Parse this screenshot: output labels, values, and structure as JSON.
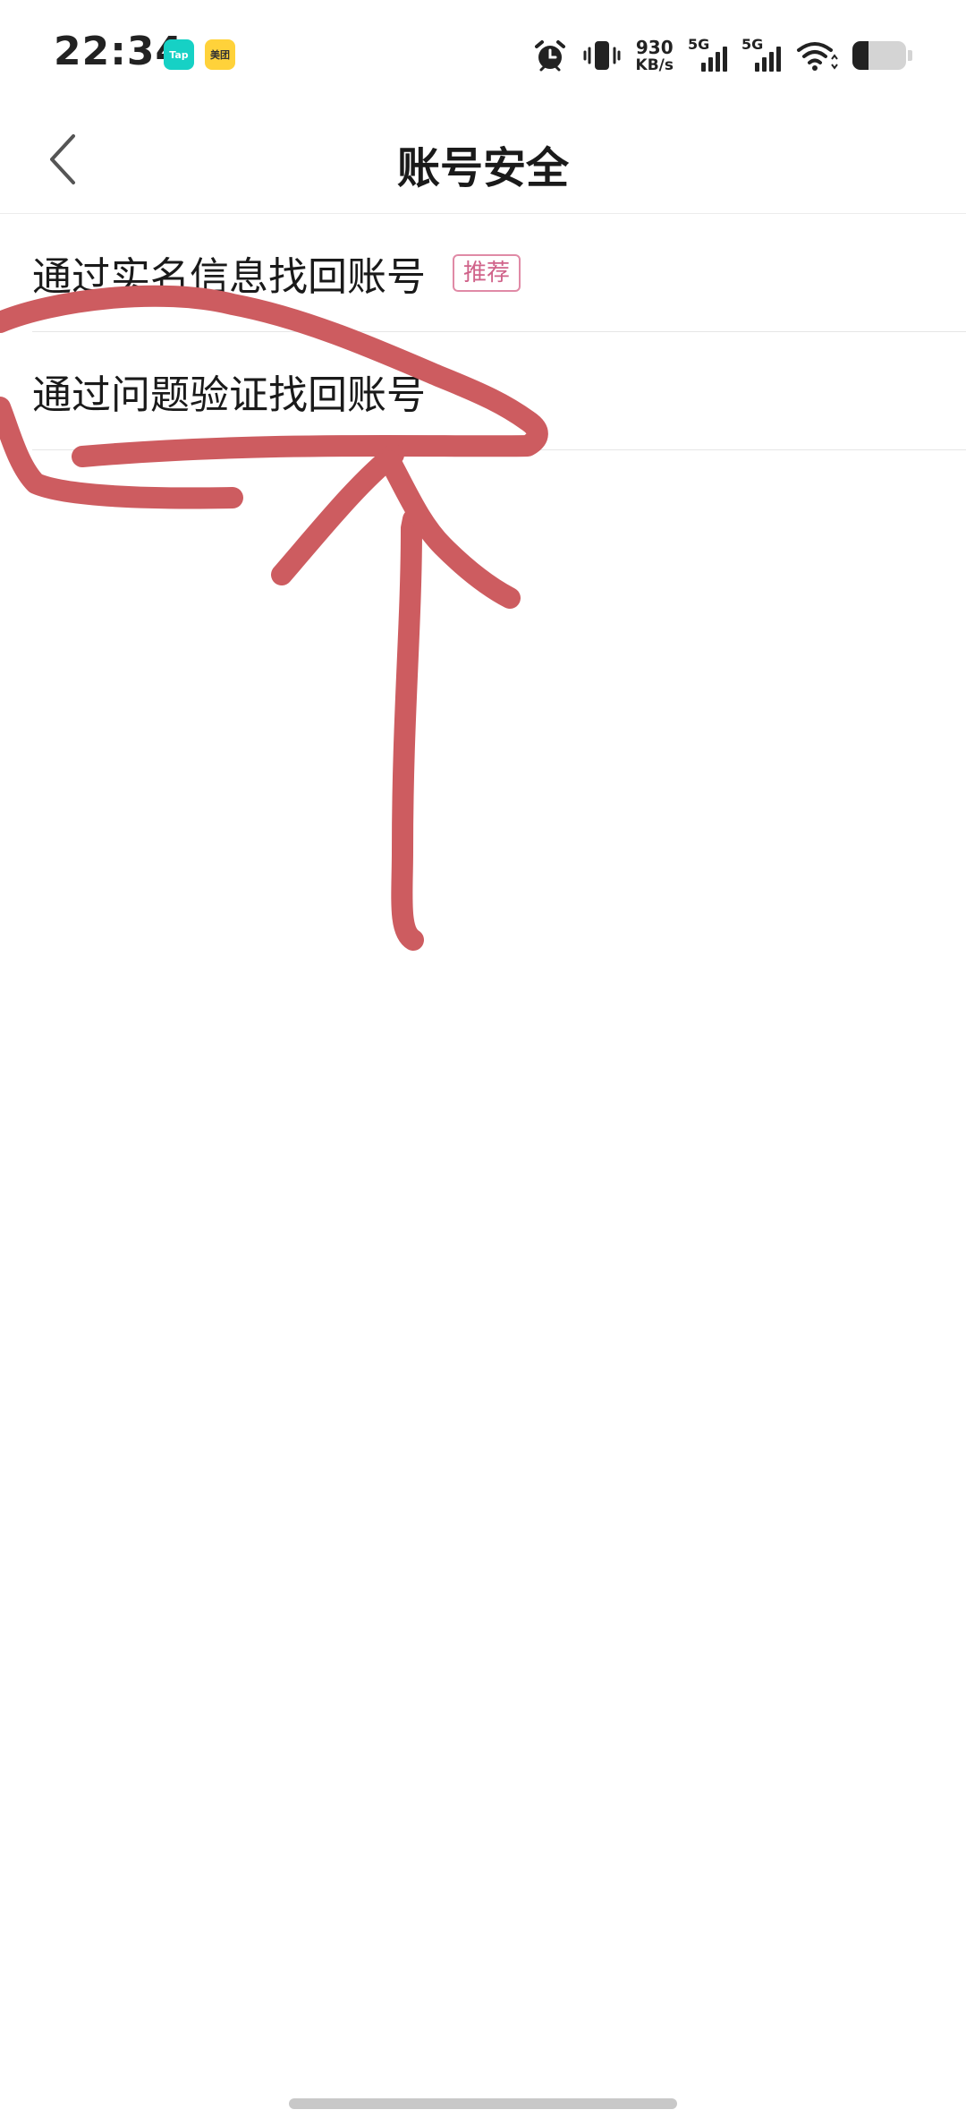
{
  "status_bar": {
    "time": "22:34",
    "apps": [
      {
        "name": "tap-icon",
        "label": "Tap",
        "color": "#16d1c5"
      },
      {
        "name": "meituan-icon",
        "label": "美团",
        "color": "#ffd23a"
      }
    ],
    "net_speed_value": "930",
    "net_speed_unit": "KB/s",
    "sim1_type": "5G",
    "sim2_type": "5G",
    "battery_level": 0.3
  },
  "nav": {
    "title": "账号安全",
    "back_icon": "chevron-left-icon"
  },
  "list": {
    "items": [
      {
        "label": "通过实名信息找回账号",
        "tag": "推荐"
      },
      {
        "label": "通过问题验证找回账号"
      }
    ]
  },
  "colors": {
    "annotation": "#cd5c60",
    "tag_border": "#e08aa6",
    "tag_text": "#d0638a"
  }
}
